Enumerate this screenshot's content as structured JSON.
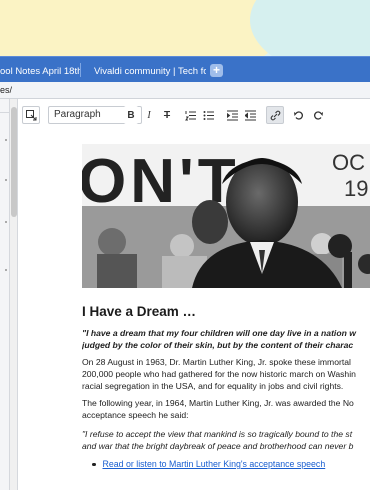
{
  "browser": {
    "tabs": [
      {
        "label": "ool Notes April 18th"
      },
      {
        "label": "Vivaldi community | Tech fo"
      }
    ],
    "address": "es/"
  },
  "toolbar": {
    "block_format": "Paragraph",
    "bold": "B",
    "italic": "I",
    "strike": "T"
  },
  "document": {
    "title": "I Have a Dream …",
    "quote1_line1": "\"I have a dream that my four children will one day live in a nation w",
    "quote1_line2": "judged by the color of their skin, but by the content of their charac",
    "para1_line1": "On 28 August in 1963, Dr. Martin Luther King, Jr. spoke these immortal",
    "para1_line2": "200,000 people who had gathered for the now historic march on Washin",
    "para1_line3": "racial segregation in the USA, and for equality in jobs and civil rights.",
    "para2_line1": "The following year, in 1964, Martin Luther King, Jr. was awarded the No",
    "para2_line2": "acceptance speech he said:",
    "quote2_line1": "\"I refuse to accept the view that mankind is so tragically bound to the st",
    "quote2_line2": "and war that the bright daybreak of peace and brotherhood can never b",
    "link": "Read or listen to Martin Luther King's acceptance speech",
    "sign_text_1": "ON'T",
    "sign_text_2": "OC",
    "sign_text_3": "19"
  }
}
